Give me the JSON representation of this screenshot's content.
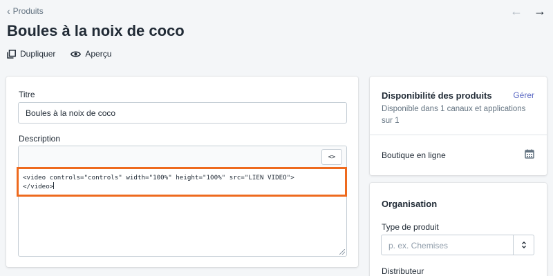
{
  "header": {
    "back_label": "Produits",
    "title": "Boules à la noix de coco",
    "actions": {
      "duplicate": "Dupliquer",
      "preview": "Aperçu"
    }
  },
  "product_form": {
    "title_label": "Titre",
    "title_value": "Boules à la noix de coco",
    "description_label": "Description",
    "code_toggle_label": "<>",
    "code_line_1": "<video controls=\"controls\" width=\"100%\" height=\"100%\" src=\"LIEN VIDEO\">",
    "code_line_2": "</video>"
  },
  "availability": {
    "title": "Disponibilité des produits",
    "manage_label": "Gérer",
    "description": "Disponible dans 1 canaux et applications sur 1",
    "channel": "Boutique en ligne"
  },
  "organization": {
    "title": "Organisation",
    "product_type_label": "Type de produit",
    "product_type_placeholder": "p. ex. Chemises",
    "vendor_label": "Distributeur"
  },
  "colors": {
    "highlight": "#ee6a1e",
    "link": "#5c6ac4",
    "background": "#f4f6f8"
  }
}
